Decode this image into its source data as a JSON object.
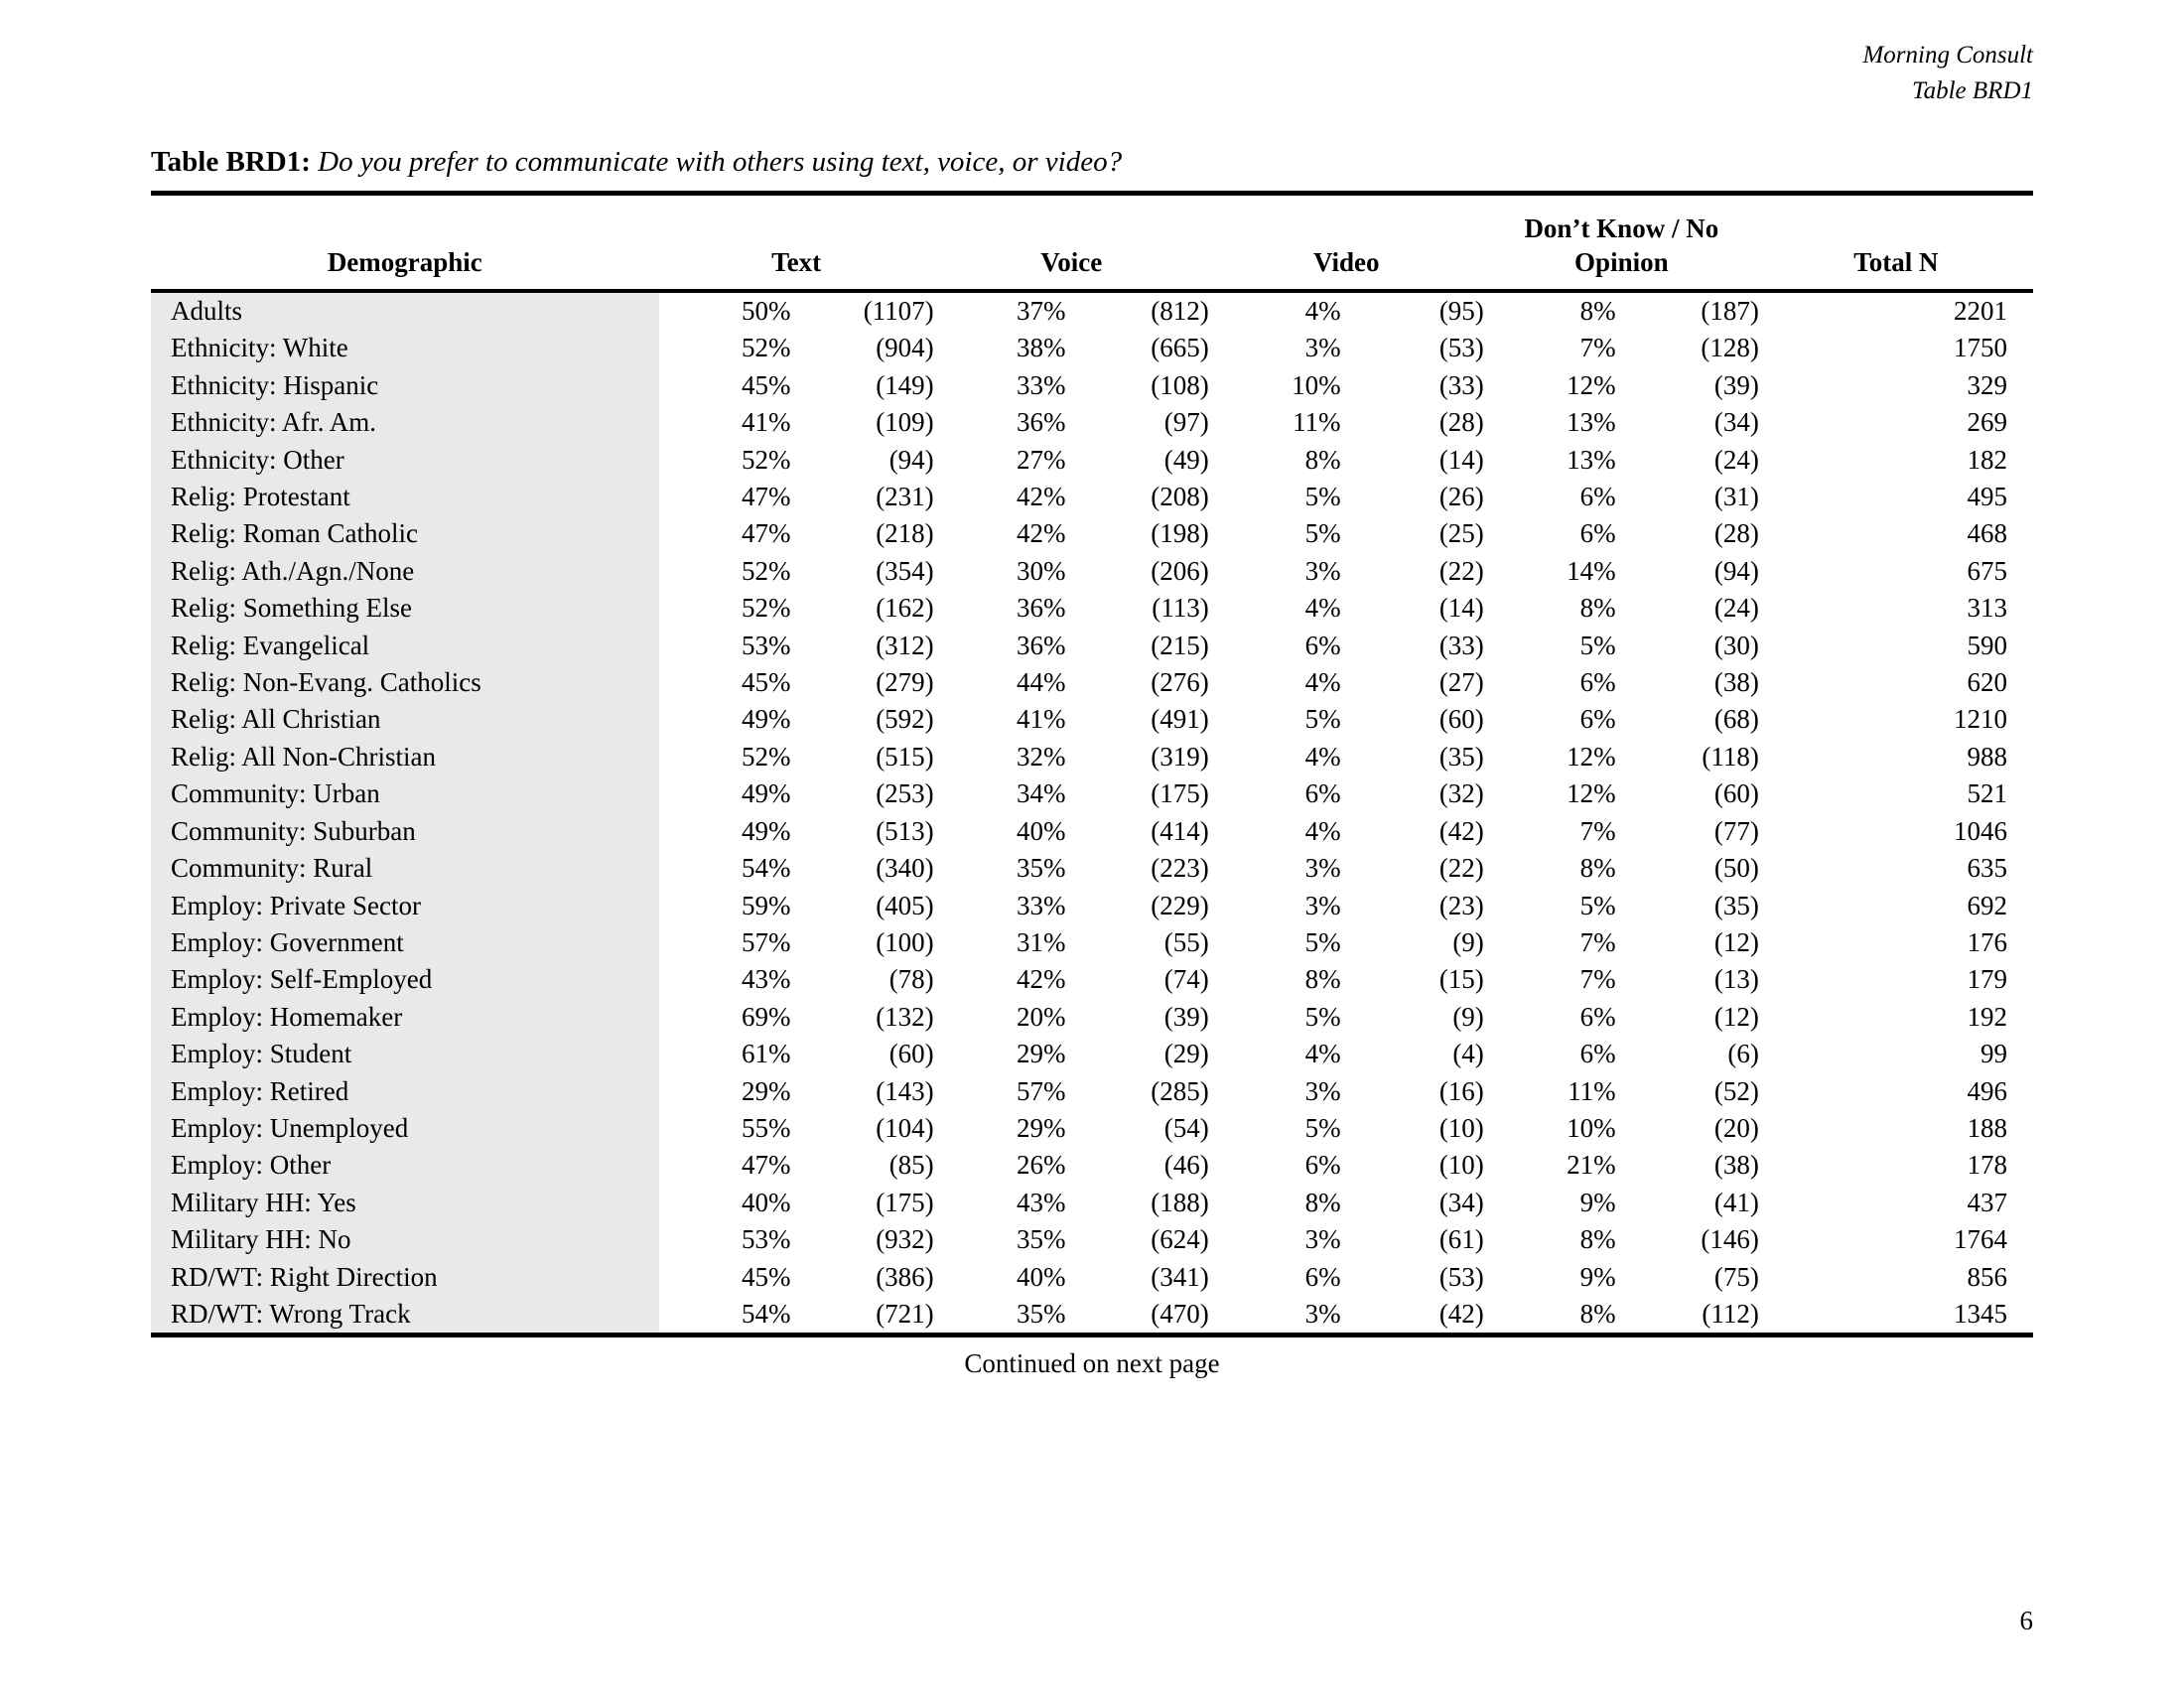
{
  "running_head": {
    "line1": "Morning Consult",
    "line2": "Table BRD1"
  },
  "caption": {
    "label": "Table BRD1:",
    "question": "Do you prefer to communicate with others using text, voice, or video?"
  },
  "table": {
    "columns": [
      {
        "key": "demographic",
        "label": "Demographic"
      },
      {
        "key": "text",
        "label": "Text"
      },
      {
        "key": "voice",
        "label": "Voice"
      },
      {
        "key": "video",
        "label": "Video"
      },
      {
        "key": "dk",
        "label_line1": "Don’t Know / No",
        "label_line2": "Opinion"
      },
      {
        "key": "total_n",
        "label": "Total N"
      }
    ],
    "rows": [
      {
        "demographic": "Adults",
        "text_pct": "50%",
        "text_n": "(1107)",
        "voice_pct": "37%",
        "voice_n": "(812)",
        "video_pct": "4%",
        "video_n": "(95)",
        "dk_pct": "8%",
        "dk_n": "(187)",
        "total_n": "2201"
      },
      {
        "demographic": "Ethnicity: White",
        "text_pct": "52%",
        "text_n": "(904)",
        "voice_pct": "38%",
        "voice_n": "(665)",
        "video_pct": "3%",
        "video_n": "(53)",
        "dk_pct": "7%",
        "dk_n": "(128)",
        "total_n": "1750"
      },
      {
        "demographic": "Ethnicity: Hispanic",
        "text_pct": "45%",
        "text_n": "(149)",
        "voice_pct": "33%",
        "voice_n": "(108)",
        "video_pct": "10%",
        "video_n": "(33)",
        "dk_pct": "12%",
        "dk_n": "(39)",
        "total_n": "329"
      },
      {
        "demographic": "Ethnicity: Afr. Am.",
        "text_pct": "41%",
        "text_n": "(109)",
        "voice_pct": "36%",
        "voice_n": "(97)",
        "video_pct": "11%",
        "video_n": "(28)",
        "dk_pct": "13%",
        "dk_n": "(34)",
        "total_n": "269"
      },
      {
        "demographic": "Ethnicity: Other",
        "text_pct": "52%",
        "text_n": "(94)",
        "voice_pct": "27%",
        "voice_n": "(49)",
        "video_pct": "8%",
        "video_n": "(14)",
        "dk_pct": "13%",
        "dk_n": "(24)",
        "total_n": "182"
      },
      {
        "demographic": "Relig: Protestant",
        "text_pct": "47%",
        "text_n": "(231)",
        "voice_pct": "42%",
        "voice_n": "(208)",
        "video_pct": "5%",
        "video_n": "(26)",
        "dk_pct": "6%",
        "dk_n": "(31)",
        "total_n": "495"
      },
      {
        "demographic": "Relig: Roman Catholic",
        "text_pct": "47%",
        "text_n": "(218)",
        "voice_pct": "42%",
        "voice_n": "(198)",
        "video_pct": "5%",
        "video_n": "(25)",
        "dk_pct": "6%",
        "dk_n": "(28)",
        "total_n": "468"
      },
      {
        "demographic": "Relig: Ath./Agn./None",
        "text_pct": "52%",
        "text_n": "(354)",
        "voice_pct": "30%",
        "voice_n": "(206)",
        "video_pct": "3%",
        "video_n": "(22)",
        "dk_pct": "14%",
        "dk_n": "(94)",
        "total_n": "675"
      },
      {
        "demographic": "Relig: Something Else",
        "text_pct": "52%",
        "text_n": "(162)",
        "voice_pct": "36%",
        "voice_n": "(113)",
        "video_pct": "4%",
        "video_n": "(14)",
        "dk_pct": "8%",
        "dk_n": "(24)",
        "total_n": "313"
      },
      {
        "demographic": "Relig: Evangelical",
        "text_pct": "53%",
        "text_n": "(312)",
        "voice_pct": "36%",
        "voice_n": "(215)",
        "video_pct": "6%",
        "video_n": "(33)",
        "dk_pct": "5%",
        "dk_n": "(30)",
        "total_n": "590"
      },
      {
        "demographic": "Relig: Non-Evang. Catholics",
        "text_pct": "45%",
        "text_n": "(279)",
        "voice_pct": "44%",
        "voice_n": "(276)",
        "video_pct": "4%",
        "video_n": "(27)",
        "dk_pct": "6%",
        "dk_n": "(38)",
        "total_n": "620"
      },
      {
        "demographic": "Relig: All Christian",
        "text_pct": "49%",
        "text_n": "(592)",
        "voice_pct": "41%",
        "voice_n": "(491)",
        "video_pct": "5%",
        "video_n": "(60)",
        "dk_pct": "6%",
        "dk_n": "(68)",
        "total_n": "1210"
      },
      {
        "demographic": "Relig: All Non-Christian",
        "text_pct": "52%",
        "text_n": "(515)",
        "voice_pct": "32%",
        "voice_n": "(319)",
        "video_pct": "4%",
        "video_n": "(35)",
        "dk_pct": "12%",
        "dk_n": "(118)",
        "total_n": "988"
      },
      {
        "demographic": "Community: Urban",
        "text_pct": "49%",
        "text_n": "(253)",
        "voice_pct": "34%",
        "voice_n": "(175)",
        "video_pct": "6%",
        "video_n": "(32)",
        "dk_pct": "12%",
        "dk_n": "(60)",
        "total_n": "521"
      },
      {
        "demographic": "Community: Suburban",
        "text_pct": "49%",
        "text_n": "(513)",
        "voice_pct": "40%",
        "voice_n": "(414)",
        "video_pct": "4%",
        "video_n": "(42)",
        "dk_pct": "7%",
        "dk_n": "(77)",
        "total_n": "1046"
      },
      {
        "demographic": "Community: Rural",
        "text_pct": "54%",
        "text_n": "(340)",
        "voice_pct": "35%",
        "voice_n": "(223)",
        "video_pct": "3%",
        "video_n": "(22)",
        "dk_pct": "8%",
        "dk_n": "(50)",
        "total_n": "635"
      },
      {
        "demographic": "Employ: Private Sector",
        "text_pct": "59%",
        "text_n": "(405)",
        "voice_pct": "33%",
        "voice_n": "(229)",
        "video_pct": "3%",
        "video_n": "(23)",
        "dk_pct": "5%",
        "dk_n": "(35)",
        "total_n": "692"
      },
      {
        "demographic": "Employ: Government",
        "text_pct": "57%",
        "text_n": "(100)",
        "voice_pct": "31%",
        "voice_n": "(55)",
        "video_pct": "5%",
        "video_n": "(9)",
        "dk_pct": "7%",
        "dk_n": "(12)",
        "total_n": "176"
      },
      {
        "demographic": "Employ: Self-Employed",
        "text_pct": "43%",
        "text_n": "(78)",
        "voice_pct": "42%",
        "voice_n": "(74)",
        "video_pct": "8%",
        "video_n": "(15)",
        "dk_pct": "7%",
        "dk_n": "(13)",
        "total_n": "179"
      },
      {
        "demographic": "Employ: Homemaker",
        "text_pct": "69%",
        "text_n": "(132)",
        "voice_pct": "20%",
        "voice_n": "(39)",
        "video_pct": "5%",
        "video_n": "(9)",
        "dk_pct": "6%",
        "dk_n": "(12)",
        "total_n": "192"
      },
      {
        "demographic": "Employ: Student",
        "text_pct": "61%",
        "text_n": "(60)",
        "voice_pct": "29%",
        "voice_n": "(29)",
        "video_pct": "4%",
        "video_n": "(4)",
        "dk_pct": "6%",
        "dk_n": "(6)",
        "total_n": "99"
      },
      {
        "demographic": "Employ: Retired",
        "text_pct": "29%",
        "text_n": "(143)",
        "voice_pct": "57%",
        "voice_n": "(285)",
        "video_pct": "3%",
        "video_n": "(16)",
        "dk_pct": "11%",
        "dk_n": "(52)",
        "total_n": "496"
      },
      {
        "demographic": "Employ: Unemployed",
        "text_pct": "55%",
        "text_n": "(104)",
        "voice_pct": "29%",
        "voice_n": "(54)",
        "video_pct": "5%",
        "video_n": "(10)",
        "dk_pct": "10%",
        "dk_n": "(20)",
        "total_n": "188"
      },
      {
        "demographic": "Employ: Other",
        "text_pct": "47%",
        "text_n": "(85)",
        "voice_pct": "26%",
        "voice_n": "(46)",
        "video_pct": "6%",
        "video_n": "(10)",
        "dk_pct": "21%",
        "dk_n": "(38)",
        "total_n": "178"
      },
      {
        "demographic": "Military HH: Yes",
        "text_pct": "40%",
        "text_n": "(175)",
        "voice_pct": "43%",
        "voice_n": "(188)",
        "video_pct": "8%",
        "video_n": "(34)",
        "dk_pct": "9%",
        "dk_n": "(41)",
        "total_n": "437"
      },
      {
        "demographic": "Military HH: No",
        "text_pct": "53%",
        "text_n": "(932)",
        "voice_pct": "35%",
        "voice_n": "(624)",
        "video_pct": "3%",
        "video_n": "(61)",
        "dk_pct": "8%",
        "dk_n": "(146)",
        "total_n": "1764"
      },
      {
        "demographic": "RD/WT: Right Direction",
        "text_pct": "45%",
        "text_n": "(386)",
        "voice_pct": "40%",
        "voice_n": "(341)",
        "video_pct": "6%",
        "video_n": "(53)",
        "dk_pct": "9%",
        "dk_n": "(75)",
        "total_n": "856"
      },
      {
        "demographic": "RD/WT: Wrong Track",
        "text_pct": "54%",
        "text_n": "(721)",
        "voice_pct": "35%",
        "voice_n": "(470)",
        "video_pct": "3%",
        "video_n": "(42)",
        "dk_pct": "8%",
        "dk_n": "(112)",
        "total_n": "1345"
      }
    ]
  },
  "footer": {
    "continued": "Continued on next page",
    "page_number": "6"
  },
  "colors": {
    "row_band": "#e9e9e9",
    "rule": "#000000",
    "text": "#000000"
  }
}
